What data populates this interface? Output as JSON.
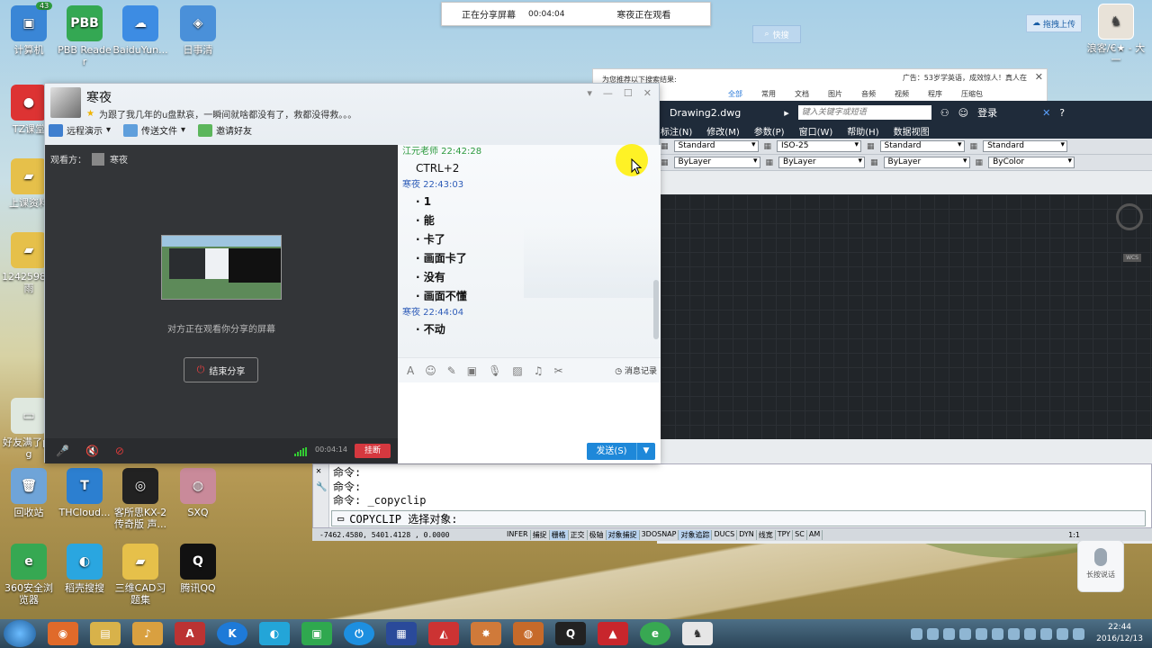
{
  "desktop_icons": [
    {
      "label": "计算机",
      "badge": "43",
      "color": "#3a86d6",
      "glyph": "▣"
    },
    {
      "label": "PBB Reader",
      "color": "#34a853",
      "glyph": "PBB"
    },
    {
      "label": "BaiduYun...",
      "color": "#3d8ce3",
      "glyph": "☁"
    },
    {
      "label": "日事清",
      "color": "#4a90d9",
      "glyph": "◈"
    },
    {
      "label": "TZ课堂",
      "color": "#d33",
      "glyph": "●"
    },
    {
      "label": "上课资料",
      "color": "#e6c04a",
      "glyph": "▰"
    },
    {
      "label": "1242598思雨",
      "color": "#e6c04a",
      "glyph": "▰"
    },
    {
      "label": "好友满了png",
      "color": "#dfe8df",
      "glyph": "▭"
    },
    {
      "label": "回收站",
      "color": "#6fa4d8",
      "glyph": "🗑"
    },
    {
      "label": "THCloud...",
      "color": "#2c7fd0",
      "glyph": "T"
    },
    {
      "label": "客所思KX-2传奇版 声...",
      "color": "#222",
      "glyph": "◎"
    },
    {
      "label": "SXQ",
      "color": "#c98a9a",
      "glyph": "◍"
    },
    {
      "label": "360安全浏览器",
      "color": "#36a852",
      "glyph": "e"
    },
    {
      "label": "稻壳搜搜",
      "color": "#2aa6e0",
      "glyph": "◐"
    },
    {
      "label": "三维CAD习题集",
      "color": "#e6c04a",
      "glyph": "▰"
    },
    {
      "label": "腾讯QQ",
      "color": "#111",
      "glyph": "Q"
    }
  ],
  "right_desktop": {
    "label": "浪客/€★ - 大一"
  },
  "share_bar": {
    "status": "正在分享屏幕",
    "time": "00:04:04",
    "viewer": "寒夜正在观看"
  },
  "quick_button": "快搜",
  "baidu_upload": "拖拽上传",
  "search_popup": {
    "title": "为您推荐以下搜索结果:",
    "ad": "广告：53岁学英语，成效惊人！真人在",
    "tabs": [
      "全部",
      "常用",
      "文档",
      "图片",
      "音频",
      "视频",
      "程序",
      "压缩包"
    ]
  },
  "cad": {
    "doc_title": "Drawing2.dwg",
    "search_placeholder": "键入关键字或短语",
    "login": "登录",
    "menu": [
      "标注(N)",
      "修改(M)",
      "参数(P)",
      "窗口(W)",
      "帮助(H)",
      "数据视图"
    ],
    "toolbar1": [
      "Standard",
      "ISO-25",
      "Standard",
      "Standard"
    ],
    "toolbar2": [
      "ByLayer",
      "ByLayer",
      "ByLayer",
      "ByColor"
    ],
    "wcs": "WCS",
    "command_history": [
      "命令:",
      "命令:",
      "命令: _copyclip"
    ],
    "command_current": "COPYCLIP 选择对象:",
    "coords": "-7462.4580, 5401.4128 , 0.0000",
    "status_toggles": [
      {
        "label": "INFER",
        "on": false
      },
      {
        "label": "捕捉",
        "on": false
      },
      {
        "label": "栅格",
        "on": true
      },
      {
        "label": "正交",
        "on": false
      },
      {
        "label": "极轴",
        "on": false
      },
      {
        "label": "对象捕捉",
        "on": true
      },
      {
        "label": "3DOSNAP",
        "on": false
      },
      {
        "label": "对象追踪",
        "on": true
      },
      {
        "label": "DUCS",
        "on": false
      },
      {
        "label": "DYN",
        "on": false
      },
      {
        "label": "线宽",
        "on": false
      },
      {
        "label": "TPY",
        "on": false
      },
      {
        "label": "SC",
        "on": false
      },
      {
        "label": "AM",
        "on": false
      }
    ],
    "scale": "1:1"
  },
  "qq": {
    "name": "寒夜",
    "signature": "为跟了我几年的u盘默哀，一瞬间就啥都没有了，救都没得救。。。",
    "tools": [
      "远程演示",
      "传送文件",
      "邀请好友"
    ],
    "viewer_label": "观看方：",
    "viewer_name": "寒夜",
    "watching_text": "对方正在观看你分享的屏幕",
    "end_share": "结束分享",
    "call_time": "00:04:14",
    "hangup": "挂断",
    "chat": [
      {
        "sender": "江元老师",
        "time": "22:42:28",
        "style": "teacher",
        "lines": [
          "CTRL+2"
        ]
      },
      {
        "sender": "寒夜",
        "time": "22:43:03",
        "style": "friend",
        "lines": [
          "1",
          "能",
          "卡了",
          "画面卡了",
          "没有",
          "画面不懂"
        ]
      },
      {
        "sender": "寒夜",
        "time": "22:44:04",
        "style": "friend",
        "lines": [
          "不动"
        ]
      }
    ],
    "history": "消息记录",
    "send": "发送(S)"
  },
  "voice_assist": "长按说话",
  "clock": {
    "time": "22:44",
    "date": "2016/12/13"
  }
}
